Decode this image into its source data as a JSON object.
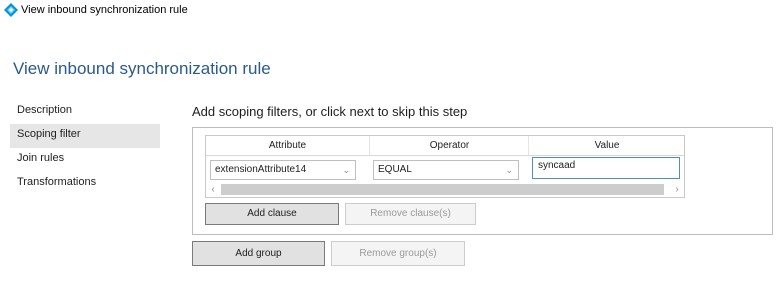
{
  "window": {
    "title": "View inbound synchronization rule",
    "icon": "azure-sync-diamond-icon",
    "icon_color": "#0096d6"
  },
  "page": {
    "title": "View inbound synchronization rule"
  },
  "nav": {
    "items": [
      {
        "label": "Description",
        "selected": false
      },
      {
        "label": "Scoping filter",
        "selected": true
      },
      {
        "label": "Join rules",
        "selected": false
      },
      {
        "label": "Transformations",
        "selected": false
      }
    ]
  },
  "scoping": {
    "heading": "Add scoping filters, or click next to skip this step",
    "columns": [
      "Attribute",
      "Operator",
      "Value"
    ],
    "row": {
      "attribute": "extensionAttribute14",
      "operator": "EQUAL",
      "value": "syncaad"
    },
    "add_clause_label": "Add clause",
    "remove_clause_label": "Remove clause(s)",
    "add_group_label": "Add group",
    "remove_group_label": "Remove group(s)"
  },
  "colors": {
    "title_blue": "#2a5a8c",
    "selected_nav": "#e6e6e6",
    "focus_border": "#4a8fd4"
  }
}
